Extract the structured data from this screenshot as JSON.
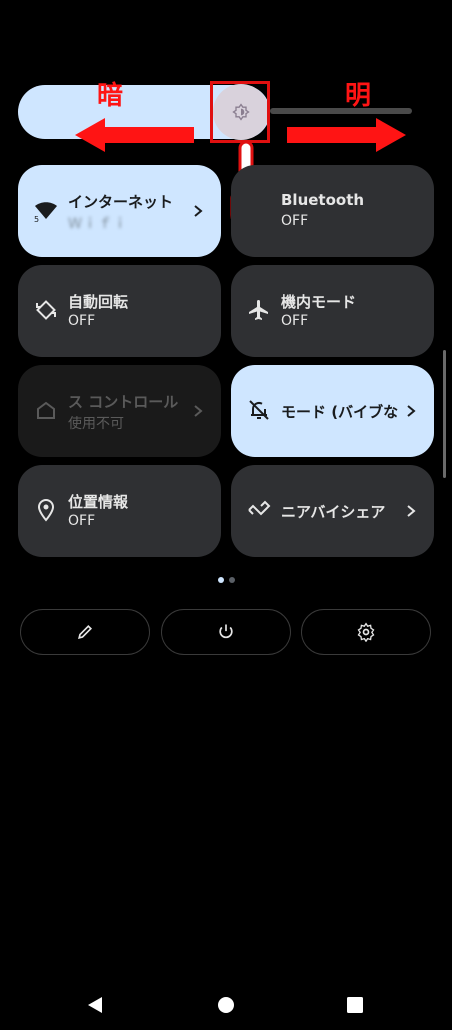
{
  "annotation": {
    "dark_label": "暗",
    "bright_label": "明"
  },
  "tiles": [
    {
      "title": "インターネット",
      "subtitle": "Ｗｉｆｉ",
      "state": "on"
    },
    {
      "title": "Bluetooth",
      "subtitle": "OFF",
      "state": "off"
    },
    {
      "title": "自動回転",
      "subtitle": "OFF",
      "state": "off"
    },
    {
      "title": "機内モード",
      "subtitle": "OFF",
      "state": "off"
    },
    {
      "title": "ス コントロール",
      "subtitle": "使用不可",
      "state": "disabled"
    },
    {
      "title": "モード (バイブな",
      "subtitle": "",
      "state": "on"
    },
    {
      "title": "位置情報",
      "subtitle": "OFF",
      "state": "off"
    },
    {
      "title": "ニアバイシェア",
      "subtitle": "",
      "state": "off"
    }
  ],
  "colors": {
    "tile_on": "#cfe6ff",
    "tile_off": "#2f3033",
    "annotation_red": "#ff1414"
  },
  "icons": [
    "wifi-icon",
    "bluetooth-icon",
    "rotate-icon",
    "airplane-icon",
    "home-icon",
    "bell-off-icon",
    "location-icon",
    "nearby-share-icon",
    "pencil-icon",
    "power-icon",
    "gear-icon",
    "back-icon",
    "home-nav-icon",
    "recents-icon",
    "brightness-icon",
    "hand-pointer-icon"
  ],
  "page_indicator": {
    "pages": 2,
    "current": 1
  }
}
